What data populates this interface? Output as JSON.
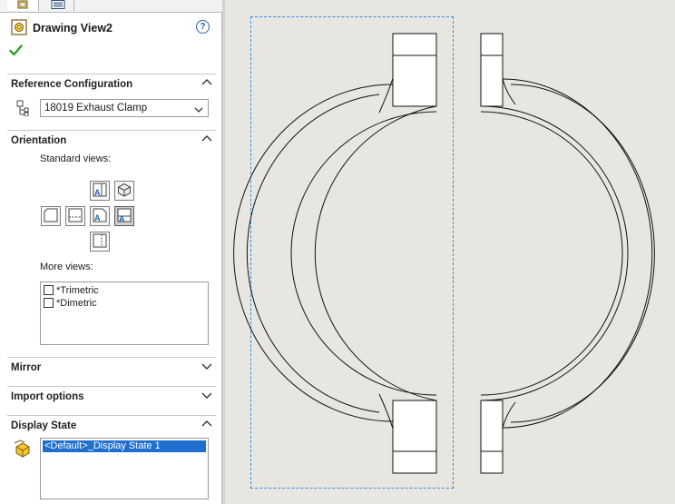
{
  "property_manager": {
    "title": "Drawing View2",
    "help_label": "?",
    "sections": {
      "reference_configuration": {
        "label": "Reference Configuration",
        "selected_configuration": "18019 Exhaust Clamp"
      },
      "orientation": {
        "label": "Orientation",
        "standard_views_label": "Standard views:",
        "more_views_label": "More views:",
        "more_views": [
          {
            "label": "*Trimetric",
            "checked": false
          },
          {
            "label": "*Dimetric",
            "checked": false
          }
        ]
      },
      "mirror": {
        "label": "Mirror"
      },
      "import_options": {
        "label": "Import options"
      },
      "display_state": {
        "label": "Display State",
        "selected": "<Default>_Display State 1"
      }
    }
  },
  "colors": {
    "selection_blue": "#1e6fd0",
    "view_border": "#2e8fe0",
    "ok_green": "#2f9e2f",
    "canvas_bg": "#e8e6e0"
  },
  "icons": {
    "tab1": "property-manager-icon",
    "tab2": "configuration-list-icon",
    "title": "drawing-view-icon",
    "ok": "checkmark-icon",
    "help": "help-icon",
    "config": "configuration-icon",
    "display_state": "display-state-icon"
  }
}
